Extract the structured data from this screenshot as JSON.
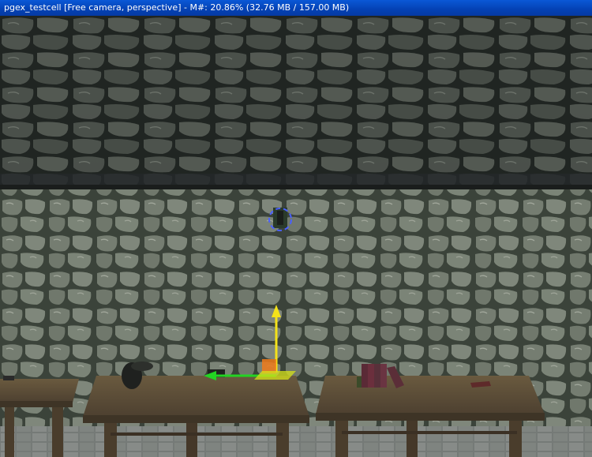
{
  "window": {
    "title": "pgex_testcell [Free camera, perspective] - M#: 20.86% (32.76 MB / 157.00 MB)"
  },
  "viewport": {
    "scene": {
      "ceiling": "cobblestone ceiling",
      "wall": "cobblestone wall",
      "floor": "stone floor",
      "objects": [
        "wooden table",
        "wooden table",
        "wooden table",
        "book stack",
        "book",
        "candle holder",
        "pot"
      ]
    },
    "gizmo": {
      "y_axis_color": "#f4e21a",
      "x_axis_color": "#23d423",
      "center_color": "#f07a1a"
    },
    "selection_marker_color": "#4a60ff"
  }
}
